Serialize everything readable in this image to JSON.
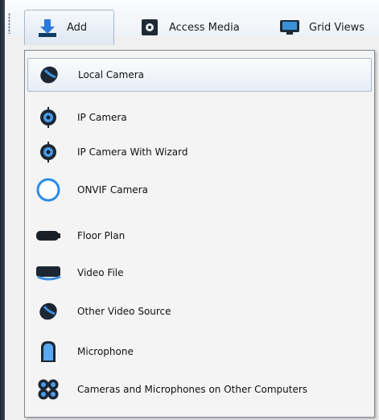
{
  "toolbar": {
    "add_label": "Add",
    "access_media_label": "Access Media",
    "grid_views_label": "Grid Views"
  },
  "menu": {
    "items": [
      {
        "label": "Local Camera",
        "icon": "local-camera-icon"
      },
      {
        "label": "IP Camera",
        "icon": "ip-camera-icon"
      },
      {
        "label": "IP Camera With Wizard",
        "icon": "ip-camera-wizard-icon"
      },
      {
        "label": "ONVIF Camera",
        "icon": "onvif-camera-icon"
      },
      {
        "label": "Floor Plan",
        "icon": "floor-plan-icon"
      },
      {
        "label": "Video File",
        "icon": "video-file-icon"
      },
      {
        "label": "Other Video Source",
        "icon": "other-video-source-icon"
      },
      {
        "label": "Microphone",
        "icon": "microphone-icon"
      },
      {
        "label": "Cameras and Microphones on Other Computers",
        "icon": "remote-devices-icon"
      }
    ]
  },
  "colors": {
    "accent_blue": "#1e88e5",
    "dark_icon": "#1c2733",
    "hover_border": "#a6b8cf"
  }
}
